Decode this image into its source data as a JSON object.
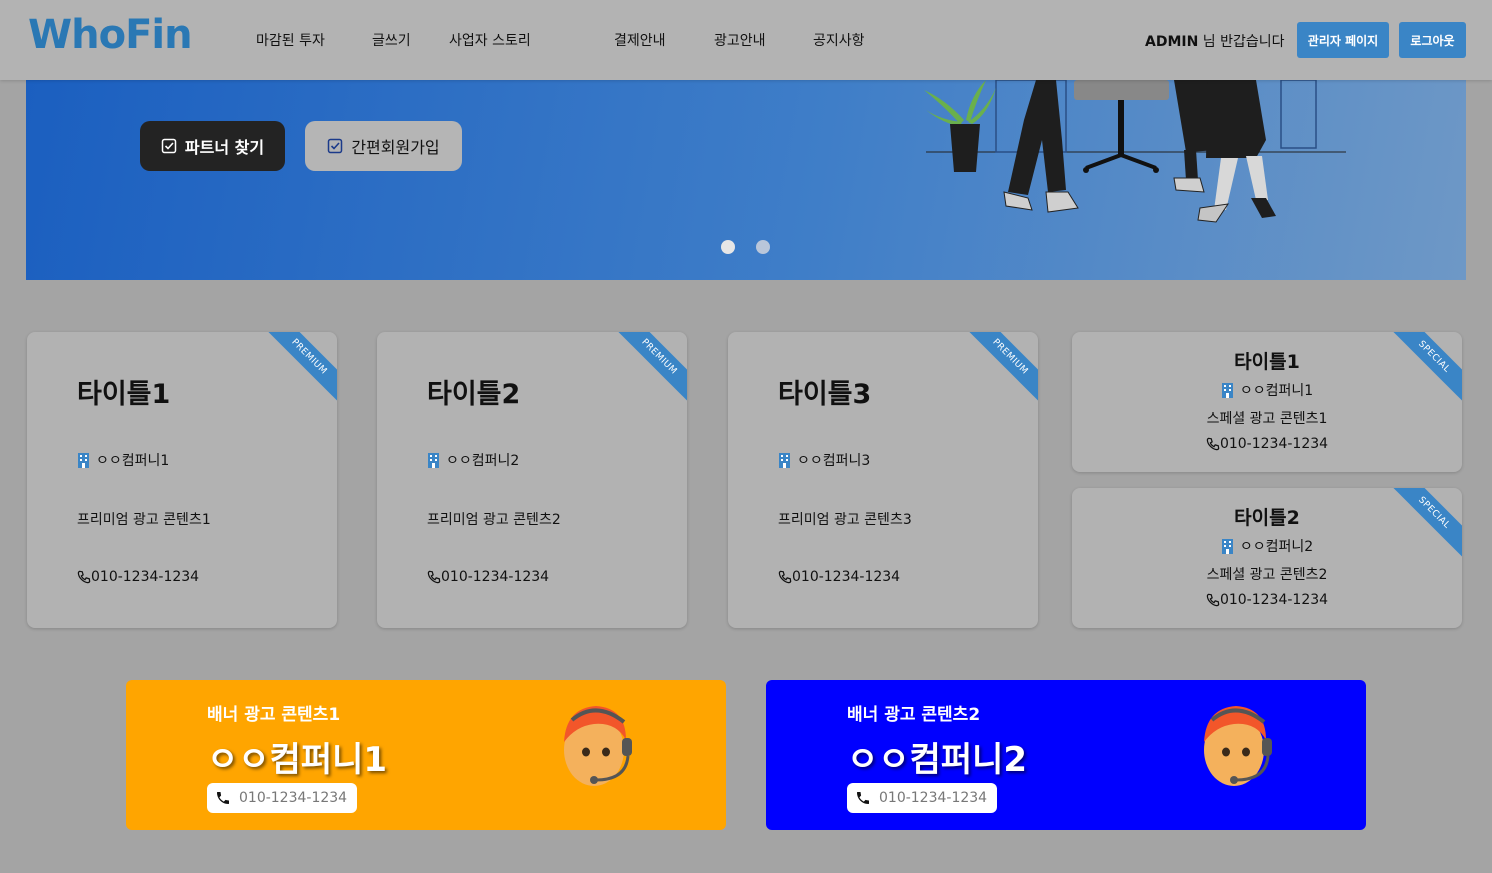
{
  "header": {
    "logo": "WhoFin",
    "nav": [
      "마감된 투자",
      "글쓰기",
      "사업자 스토리",
      "결제안내",
      "광고안내",
      "공지사항"
    ],
    "user": "ADMIN",
    "greeting": "님 반갑습니다",
    "admin_button": "관리자 페이지",
    "logout_button": "로그아웃"
  },
  "hero": {
    "find_partner": "파트너 찾기",
    "signup": "간편회원가입",
    "slides": 2,
    "active_slide": 1
  },
  "premium": [
    {
      "ribbon": "PREMIUM",
      "title": "타이틀1",
      "company": "ㅇㅇ컴퍼니1",
      "content": "프리미엄 광고 콘텐츠1",
      "phone": "010-1234-1234"
    },
    {
      "ribbon": "PREMIUM",
      "title": "타이틀2",
      "company": "ㅇㅇ컴퍼니2",
      "content": "프리미엄 광고 콘텐츠2",
      "phone": "010-1234-1234"
    },
    {
      "ribbon": "PREMIUM",
      "title": "타이틀3",
      "company": "ㅇㅇ컴퍼니3",
      "content": "프리미엄 광고 콘텐츠3",
      "phone": "010-1234-1234"
    }
  ],
  "special": [
    {
      "ribbon": "SPECIAL",
      "title": "타이틀1",
      "company": "ㅇㅇ컴퍼니1",
      "content": "스페셜 광고 콘텐츠1",
      "phone": "010-1234-1234"
    },
    {
      "ribbon": "SPECIAL",
      "title": "타이틀2",
      "company": "ㅇㅇ컴퍼니2",
      "content": "스페셜 광고 콘텐츠2",
      "phone": "010-1234-1234"
    }
  ],
  "banners": [
    {
      "subtitle": "배너 광고 콘텐츠1",
      "company": "ㅇㅇ컴퍼니1",
      "phone": "010-1234-1234",
      "color": "#ffa500"
    },
    {
      "subtitle": "배너 광고 콘텐츠2",
      "company": "ㅇㅇ컴퍼니2",
      "phone": "010-1234-1234",
      "color": "#0000ff"
    }
  ],
  "colors": {
    "accent": "#3a85c6",
    "page_bg": "#a4a4a4"
  },
  "icons": {
    "building": "building-icon",
    "phone": "phone-icon",
    "check": "check-square-icon",
    "agent": "support-agent-icon"
  }
}
